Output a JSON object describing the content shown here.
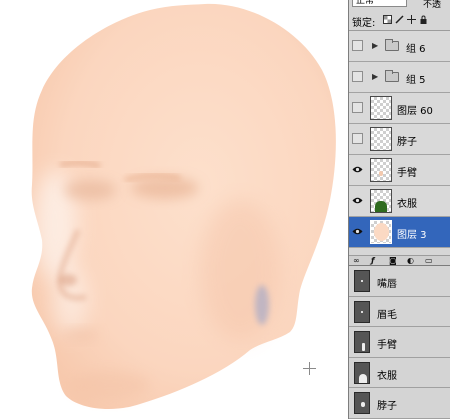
{
  "layers_panel": {
    "blend_mode": "正常",
    "opacity_label": "不透",
    "lock_label": "锁定:",
    "lock_icons": [
      "transparency-lock-icon",
      "brush-lock-icon",
      "move-lock-icon",
      "padlock-icon"
    ],
    "layers": [
      {
        "name": "组 6",
        "type": "group",
        "visible": false,
        "selected": false
      },
      {
        "name": "组 5",
        "type": "group",
        "visible": false,
        "selected": false
      },
      {
        "name": "图层 60",
        "type": "layer",
        "visible": false,
        "selected": false
      },
      {
        "name": "脖子",
        "type": "layer",
        "visible": false,
        "selected": false
      },
      {
        "name": "手臂",
        "type": "layer",
        "visible": true,
        "selected": false
      },
      {
        "name": "衣服",
        "type": "layer",
        "visible": true,
        "selected": false
      },
      {
        "name": "图层 3",
        "type": "layer",
        "visible": true,
        "selected": true
      }
    ]
  },
  "paths_panel": {
    "paths": [
      {
        "name": "嘴唇"
      },
      {
        "name": "眉毛"
      },
      {
        "name": "手臂"
      },
      {
        "name": "衣服"
      },
      {
        "name": "脖子"
      }
    ]
  },
  "colors": {
    "skin": "#fbd9c3",
    "selection": "#3366bb",
    "panel_bg": "#d6d6d6"
  }
}
